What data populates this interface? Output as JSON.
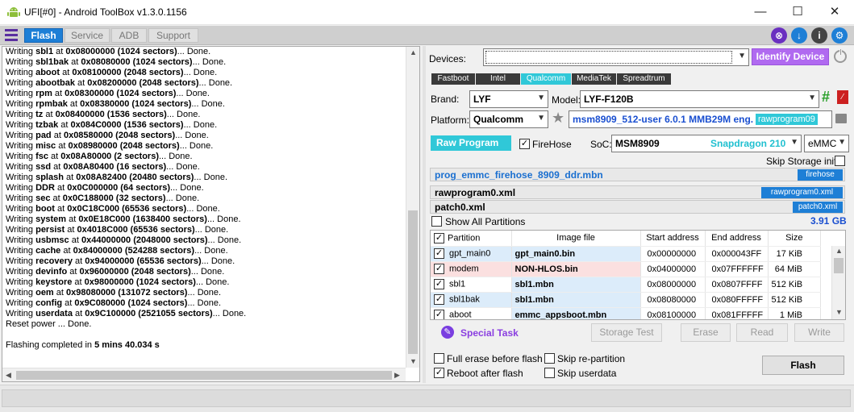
{
  "window": {
    "title": "UFI[#0] - Android ToolBox v1.3.0.1156",
    "minimize": "—",
    "maximize": "☐",
    "close": "✕"
  },
  "toolbar": {
    "tabs": [
      "Flash",
      "Service",
      "ADB",
      "Support"
    ]
  },
  "log": {
    "lines": [
      {
        "pre": "Writing ",
        "name": "sbl1",
        "mid": " at ",
        "info": "0x08000000 (1024 sectors)",
        "post": "... Done."
      },
      {
        "pre": "Writing ",
        "name": "sbl1bak",
        "mid": " at ",
        "info": "0x08080000 (1024 sectors)",
        "post": "... Done."
      },
      {
        "pre": "Writing ",
        "name": "aboot",
        "mid": " at ",
        "info": "0x08100000 (2048 sectors)",
        "post": "... Done."
      },
      {
        "pre": "Writing ",
        "name": "abootbak",
        "mid": " at ",
        "info": "0x08200000 (2048 sectors)",
        "post": "... Done."
      },
      {
        "pre": "Writing ",
        "name": "rpm",
        "mid": " at ",
        "info": "0x08300000 (1024 sectors)",
        "post": "... Done."
      },
      {
        "pre": "Writing ",
        "name": "rpmbak",
        "mid": " at ",
        "info": "0x08380000 (1024 sectors)",
        "post": "... Done."
      },
      {
        "pre": "Writing ",
        "name": "tz",
        "mid": " at ",
        "info": "0x08400000 (1536 sectors)",
        "post": "... Done."
      },
      {
        "pre": "Writing ",
        "name": "tzbak",
        "mid": " at ",
        "info": "0x084C0000 (1536 sectors)",
        "post": "... Done."
      },
      {
        "pre": "Writing ",
        "name": "pad",
        "mid": " at ",
        "info": "0x08580000 (2048 sectors)",
        "post": "... Done."
      },
      {
        "pre": "Writing ",
        "name": "misc",
        "mid": " at ",
        "info": "0x08980000 (2048 sectors)",
        "post": "... Done."
      },
      {
        "pre": "Writing ",
        "name": "fsc",
        "mid": " at ",
        "info": "0x08A80000 (2 sectors)",
        "post": "... Done."
      },
      {
        "pre": "Writing ",
        "name": "ssd",
        "mid": " at ",
        "info": "0x08A80400 (16 sectors)",
        "post": "... Done."
      },
      {
        "pre": "Writing ",
        "name": "splash",
        "mid": " at ",
        "info": "0x08A82400 (20480 sectors)",
        "post": "... Done."
      },
      {
        "pre": "Writing ",
        "name": "DDR",
        "mid": " at ",
        "info": "0x0C000000 (64 sectors)",
        "post": "... Done."
      },
      {
        "pre": "Writing ",
        "name": "sec",
        "mid": " at ",
        "info": "0x0C188000 (32 sectors)",
        "post": "... Done."
      },
      {
        "pre": "Writing ",
        "name": "boot",
        "mid": " at ",
        "info": "0x0C18C000 (65536 sectors)",
        "post": "... Done."
      },
      {
        "pre": "Writing ",
        "name": "system",
        "mid": " at ",
        "info": "0x0E18C000 (1638400 sectors)",
        "post": "... Done."
      },
      {
        "pre": "Writing ",
        "name": "persist",
        "mid": " at ",
        "info": "0x4018C000 (65536 sectors)",
        "post": "... Done."
      },
      {
        "pre": "Writing ",
        "name": "usbmsc",
        "mid": " at ",
        "info": "0x44000000 (2048000 sectors)",
        "post": "... Done."
      },
      {
        "pre": "Writing ",
        "name": "cache",
        "mid": " at ",
        "info": "0x84000000 (524288 sectors)",
        "post": "... Done."
      },
      {
        "pre": "Writing ",
        "name": "recovery",
        "mid": " at ",
        "info": "0x94000000 (65536 sectors)",
        "post": "... Done."
      },
      {
        "pre": "Writing ",
        "name": "devinfo",
        "mid": " at ",
        "info": "0x96000000 (2048 sectors)",
        "post": "... Done."
      },
      {
        "pre": "Writing ",
        "name": "keystore",
        "mid": " at ",
        "info": "0x98000000 (1024 sectors)",
        "post": "... Done."
      },
      {
        "pre": "Writing ",
        "name": "oem",
        "mid": " at ",
        "info": "0x98080000 (131072 sectors)",
        "post": "... Done."
      },
      {
        "pre": "Writing ",
        "name": "config",
        "mid": " at ",
        "info": "0x9C080000 (1024 sectors)",
        "post": "... Done."
      },
      {
        "pre": "Writing ",
        "name": "userdata",
        "mid": " at ",
        "info": "0x9C100000 (2521055 sectors)",
        "post": "... Done."
      },
      {
        "pre": "Reset power ... Done.",
        "name": "",
        "mid": "",
        "info": "",
        "post": ""
      },
      {
        "pre": "",
        "name": "",
        "mid": "",
        "info": "",
        "post": ""
      },
      {
        "pre": "Flashing completed in ",
        "name": "",
        "mid": "",
        "info": "5 mins 40.034 s",
        "post": ""
      }
    ]
  },
  "devices": {
    "label": "Devices:",
    "value": "",
    "identify_button": "Identify Device"
  },
  "chipsets": [
    "Fastboot",
    "Intel",
    "Qualcomm",
    "MediaTek",
    "Spreadtrum"
  ],
  "brand": {
    "label": "Brand:",
    "value": "LYF"
  },
  "model": {
    "label": "Model:",
    "value": "LYF-F120B"
  },
  "platform": {
    "label": "Platform:",
    "value": "Qualcomm"
  },
  "firmware": {
    "value": "msm8909_512-user 6.0.1 MMB29M eng.",
    "badge": "rawprogram09"
  },
  "raw_program": {
    "label": "Raw Program",
    "firehose_label": "FireHose",
    "firehose_checked": true
  },
  "soc": {
    "label": "SoC:",
    "value": "MSM8909",
    "name": "Snapdragon 210",
    "storage": "eMMC"
  },
  "skip_storage_init": "Skip Storage init",
  "files": {
    "firehose": {
      "name": "prog_emmc_firehose_8909_ddr.mbn",
      "tag": "firehose"
    },
    "rawprogram": {
      "name": "rawprogram0.xml",
      "tag": "rawprogram0.xml"
    },
    "patch": {
      "name": "patch0.xml",
      "tag": "patch0.xml"
    }
  },
  "show_all_partitions": "Show All Partitions",
  "total_size": "3.91 GB",
  "table": {
    "headers": [
      "Partition",
      "Image file",
      "Start address",
      "End address",
      "Size"
    ],
    "rows": [
      {
        "checked": true,
        "partition": "gpt_main0",
        "image": "gpt_main0.bin",
        "start": "0x00000000",
        "end": "0x000043FF",
        "size": "17 KiB",
        "style": "blue"
      },
      {
        "checked": true,
        "partition": "modem",
        "image": "NON-HLOS.bin",
        "start": "0x04000000",
        "end": "0x07FFFFFF",
        "size": "64 MiB",
        "style": "red"
      },
      {
        "checked": true,
        "partition": "sbl1",
        "image": "sbl1.mbn",
        "start": "0x08000000",
        "end": "0x0807FFFF",
        "size": "512 KiB",
        "style": "blue"
      },
      {
        "checked": true,
        "partition": "sbl1bak",
        "image": "sbl1.mbn",
        "start": "0x08080000",
        "end": "0x080FFFFF",
        "size": "512 KiB",
        "style": "blue"
      },
      {
        "checked": true,
        "partition": "aboot",
        "image": "emmc_appsboot.mbn",
        "start": "0x08100000",
        "end": "0x081FFFFF",
        "size": "1 MiB",
        "style": "blue"
      }
    ]
  },
  "actions": {
    "special_task": "Special Task",
    "storage_test": "Storage Test",
    "erase": "Erase",
    "read": "Read",
    "write": "Write"
  },
  "options": {
    "full_erase": "Full erase before flash",
    "reboot_after": "Reboot after flash",
    "skip_repartition": "Skip re-partition",
    "skip_userdata": "Skip userdata",
    "flash_button": "Flash"
  },
  "colors": {
    "accent_blue": "#1e7fd6",
    "identify_purple": "#b06af0",
    "raw_program_cyan": "#30c8d8",
    "soc_name_cyan": "#20c0d0",
    "firmware_blue": "#1a4fd0"
  }
}
